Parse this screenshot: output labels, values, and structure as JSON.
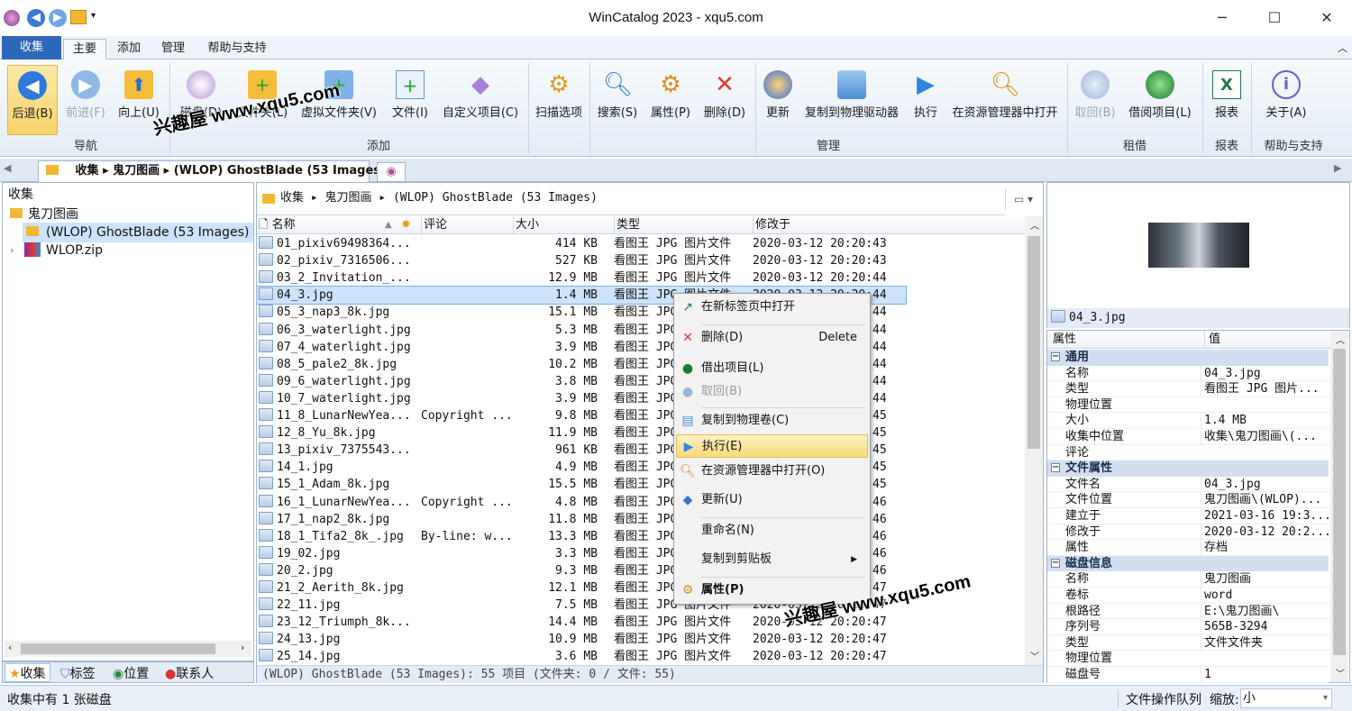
{
  "window": {
    "title": "WinCatalog 2023 - xqu5.com"
  },
  "ribbon_tabs": [
    {
      "label": "收集"
    },
    {
      "label": "主要"
    },
    {
      "label": "添加"
    },
    {
      "label": "管理"
    },
    {
      "label": "帮助与支持"
    }
  ],
  "ribbon": {
    "buttons": [
      {
        "label": "后退(B)",
        "icon": "back-arrow-icon"
      },
      {
        "label": "前进(F)",
        "icon": "forward-arrow-icon"
      },
      {
        "label": "向上(U)",
        "icon": "up-folder-icon"
      },
      {
        "label": "磁盘(D)",
        "icon": "disk-add-icon"
      },
      {
        "label": "文件夹(L)",
        "icon": "folder-add-icon"
      },
      {
        "label": "虚拟文件夹(V)",
        "icon": "virtual-folder-icon"
      },
      {
        "label": "文件(I)",
        "icon": "file-add-icon"
      },
      {
        "label": "自定义项目(C)",
        "icon": "custom-item-icon"
      },
      {
        "label": "扫描选项",
        "icon": "gear-icon"
      },
      {
        "label": "搜索(S)",
        "icon": "search-icon"
      },
      {
        "label": "属性(P)",
        "icon": "properties-icon"
      },
      {
        "label": "删除(D)",
        "icon": "delete-icon"
      },
      {
        "label": "更新",
        "icon": "update-icon"
      },
      {
        "label": "复制到物理驱动器",
        "icon": "copy-drive-icon"
      },
      {
        "label": "执行",
        "icon": "play-icon"
      },
      {
        "label": "在资源管理器中打开",
        "icon": "explorer-search-icon"
      },
      {
        "label": "取回(B)",
        "icon": "return-icon"
      },
      {
        "label": "借阅项目(L)",
        "icon": "lend-icon"
      },
      {
        "label": "报表",
        "icon": "excel-icon"
      },
      {
        "label": "关于(A)",
        "icon": "info-icon"
      }
    ],
    "groups": [
      "导航",
      "添加",
      "管理",
      "租借",
      "报表",
      "帮助与支持"
    ]
  },
  "watermark": "兴趣屋 www.xqu5.com",
  "breadcrumb_tab": {
    "parts": [
      "收集",
      "鬼刀图画",
      "(WLOP) GhostBlade (53 Images)"
    ]
  },
  "tree": {
    "root": "收集",
    "items": [
      "鬼刀图画",
      "(WLOP) GhostBlade (53 Images)",
      "WLOP.zip"
    ]
  },
  "bottom_tabs": [
    "收集",
    "标签",
    "位置",
    "联系人"
  ],
  "path_bar": "收集 ▸ 鬼刀图画 ▸ (WLOP) GhostBlade (53 Images)",
  "columns": [
    "名称",
    "评论",
    "大小",
    "类型",
    "修改于"
  ],
  "files": [
    [
      "01_pixiv69498364...",
      "",
      "414 KB",
      "看图王 JPG 图片文件",
      "2020-03-12 20:20:43"
    ],
    [
      "02_pixiv_7316506...",
      "",
      "527 KB",
      "看图王 JPG 图片文件",
      "2020-03-12 20:20:43"
    ],
    [
      "03_2_Invitation_...",
      "",
      "12.9 MB",
      "看图王 JPG 图片文件",
      "2020-03-12 20:20:44"
    ],
    [
      "04_3.jpg",
      "",
      "1.4 MB",
      "看图王 JPG 图片文件",
      "2020-03-12 20:20:44"
    ],
    [
      "05_3_nap3_8k.jpg",
      "",
      "15.1 MB",
      "看图王 JPG 图片文件",
      "2020-03-12 20:20:44"
    ],
    [
      "06_3_waterlight.jpg",
      "",
      "5.3 MB",
      "看图王 JPG 图片文件",
      "2020-03-12 20:20:44"
    ],
    [
      "07_4_waterlight.jpg",
      "",
      "3.9 MB",
      "看图王 JPG 图片文件",
      "2020-03-12 20:20:44"
    ],
    [
      "08_5_pale2_8k.jpg",
      "",
      "10.2 MB",
      "看图王 JPG 图片文件",
      "2020-03-12 20:20:44"
    ],
    [
      "09_6_waterlight.jpg",
      "",
      "3.8 MB",
      "看图王 JPG 图片文件",
      "2020-03-12 20:20:44"
    ],
    [
      "10_7_waterlight.jpg",
      "",
      "3.9 MB",
      "看图王 JPG 图片文件",
      "2020-03-12 20:20:44"
    ],
    [
      "11_8_LunarNewYea...",
      "Copyright ...",
      "9.8 MB",
      "看图王 JPG 图片文件",
      "2020-03-12 20:20:45"
    ],
    [
      "12_8_Yu_8k.jpg",
      "",
      "11.9 MB",
      "看图王 JPG 图片文件",
      "2020-03-12 20:20:45"
    ],
    [
      "13_pixiv_7375543...",
      "",
      "961 KB",
      "看图王 JPG 图片文件",
      "2020-03-12 20:20:45"
    ],
    [
      "14_1.jpg",
      "",
      "4.9 MB",
      "看图王 JPG 图片文件",
      "2020-03-12 20:20:45"
    ],
    [
      "15_1_Adam_8k.jpg",
      "",
      "15.5 MB",
      "看图王 JPG 图片文件",
      "2020-03-12 20:20:45"
    ],
    [
      "16_1_LunarNewYea...",
      "Copyright ...",
      "4.8 MB",
      "看图王 JPG 图片文件",
      "2020-03-12 20:20:46"
    ],
    [
      "17_1_nap2_8k.jpg",
      "",
      "11.8 MB",
      "看图王 JPG 图片文件",
      "2020-03-12 20:20:46"
    ],
    [
      "18_1_Tifa2_8k_.jpg",
      "By-line: w...",
      "13.3 MB",
      "看图王 JPG 图片文件",
      "2020-03-12 20:20:46"
    ],
    [
      "19_02.jpg",
      "",
      "3.3 MB",
      "看图王 JPG 图片文件",
      "2020-03-12 20:20:46"
    ],
    [
      "20_2.jpg",
      "",
      "9.3 MB",
      "看图王 JPG 图片文件",
      "2020-03-12 20:20:46"
    ],
    [
      "21_2_Aerith_8k.jpg",
      "",
      "12.1 MB",
      "看图王 JPG 图片文件",
      "2020-03-12 20:20:47"
    ],
    [
      "22_11.jpg",
      "",
      "7.5 MB",
      "看图王 JPG 图片文件",
      "2020-03-12 20:20:47"
    ],
    [
      "23_12_Triumph_8k...",
      "",
      "14.4 MB",
      "看图王 JPG 图片文件",
      "2020-03-12 20:20:47"
    ],
    [
      "24_13.jpg",
      "",
      "10.9 MB",
      "看图王 JPG 图片文件",
      "2020-03-12 20:20:47"
    ],
    [
      "25_14.jpg",
      "",
      "3.6 MB",
      "看图王 JPG 图片文件",
      "2020-03-12 20:20:47"
    ]
  ],
  "list_status": "(WLOP) GhostBlade (53 Images): 55 项目 (文件夹: 0 / 文件: 55)",
  "context_menu": [
    {
      "label": "在新标签页中打开",
      "shortcut": "",
      "icon": "open-tab-icon"
    },
    {
      "label": "删除(D)",
      "shortcut": "Delete",
      "icon": "delete-icon"
    },
    {
      "label": "借出项目(L)",
      "shortcut": "",
      "icon": "lend-icon"
    },
    {
      "label": "取回(B)",
      "shortcut": "",
      "icon": "return-icon"
    },
    {
      "label": "复制到物理卷(C)",
      "shortcut": "",
      "icon": "copy-drive-icon"
    },
    {
      "label": "执行(E)",
      "shortcut": "",
      "icon": "play-icon"
    },
    {
      "label": "在资源管理器中打开(O)",
      "shortcut": "",
      "icon": "explorer-search-icon"
    },
    {
      "label": "更新(U)",
      "shortcut": "",
      "icon": "update-icon"
    },
    {
      "label": "重命名(N)",
      "shortcut": "",
      "icon": ""
    },
    {
      "label": "复制到剪贴板",
      "shortcut": "",
      "icon": ""
    },
    {
      "label": "属性(P)",
      "shortcut": "",
      "icon": "properties-icon"
    }
  ],
  "preview": {
    "filename": "04_3.jpg"
  },
  "properties": {
    "headers": [
      "属性",
      "值"
    ],
    "rows": [
      {
        "cat": "通用"
      },
      {
        "k": "名称",
        "v": "04_3.jpg"
      },
      {
        "k": "类型",
        "v": "看图王 JPG 图片..."
      },
      {
        "k": "物理位置",
        "v": ""
      },
      {
        "k": "大小",
        "v": "1.4 MB"
      },
      {
        "k": "收集中位置",
        "v": "收集\\鬼刀图画\\(..."
      },
      {
        "k": "评论",
        "v": ""
      },
      {
        "cat": "文件属性"
      },
      {
        "k": "文件名",
        "v": "04_3.jpg"
      },
      {
        "k": "文件位置",
        "v": "鬼刀图画\\(WLOP)..."
      },
      {
        "k": "建立于",
        "v": "2021-03-16 19:3..."
      },
      {
        "k": "修改于",
        "v": "2020-03-12 20:2..."
      },
      {
        "k": "属性",
        "v": "存档"
      },
      {
        "cat": "磁盘信息"
      },
      {
        "k": "名称",
        "v": "鬼刀图画"
      },
      {
        "k": "卷标",
        "v": "word"
      },
      {
        "k": "根路径",
        "v": "E:\\鬼刀图画\\"
      },
      {
        "k": "序列号",
        "v": "565B-3294"
      },
      {
        "k": "类型",
        "v": "文件文件夹"
      },
      {
        "k": "物理位置",
        "v": ""
      },
      {
        "k": "磁盘号",
        "v": "1"
      }
    ]
  },
  "statusbar": {
    "left": "收集中有 1 张磁盘",
    "queue": "文件操作队列",
    "zoom_label": "缩放:",
    "zoom_value": "小"
  }
}
